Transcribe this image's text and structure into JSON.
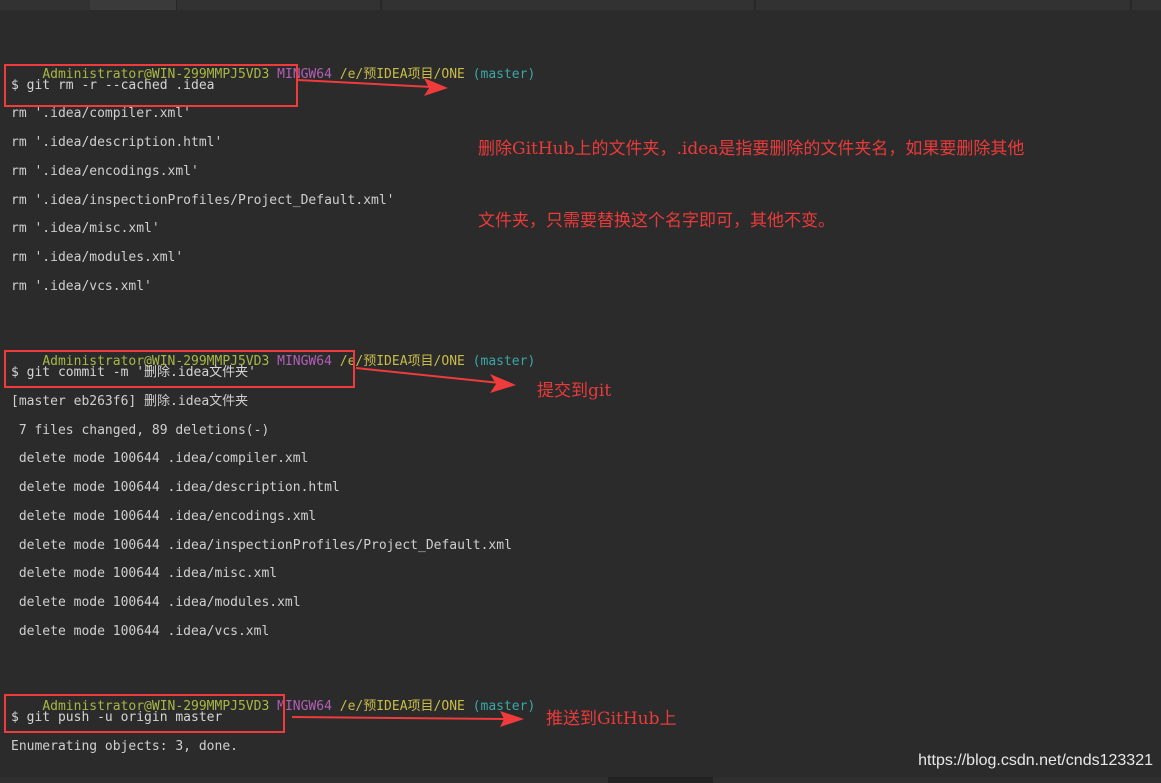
{
  "prompt": {
    "user": "Administrator@WIN-299MMPJ5VD3",
    "msys": "MINGW64",
    "path": "/e/预IDEA项目/ONE",
    "branch": "(master)"
  },
  "block1": {
    "command": "$ git rm -r --cached .idea",
    "output": [
      "rm '.idea/compiler.xml'",
      "rm '.idea/description.html'",
      "rm '.idea/encodings.xml'",
      "rm '.idea/inspectionProfiles/Project_Default.xml'",
      "rm '.idea/misc.xml'",
      "rm '.idea/modules.xml'",
      "rm '.idea/vcs.xml'"
    ],
    "annotation_line1": "删除GitHub上的文件夹，.idea是指要删除的文件夹名，如果要删除其他",
    "annotation_line2": "文件夹，只需要替换这个名字即可，其他不变。"
  },
  "block2": {
    "command": "$ git commit -m '删除.idea文件夹'",
    "output": [
      "[master eb263f6] 删除.idea文件夹",
      " 7 files changed, 89 deletions(-)",
      " delete mode 100644 .idea/compiler.xml",
      " delete mode 100644 .idea/description.html",
      " delete mode 100644 .idea/encodings.xml",
      " delete mode 100644 .idea/inspectionProfiles/Project_Default.xml",
      " delete mode 100644 .idea/misc.xml",
      " delete mode 100644 .idea/modules.xml",
      " delete mode 100644 .idea/vcs.xml"
    ],
    "annotation": "提交到git"
  },
  "block3": {
    "command": "$ git push -u origin master",
    "output": [
      "Enumerating objects: 3, done."
    ],
    "annotation": "推送到GitHub上"
  },
  "watermark": "https://blog.csdn.net/cnds123321",
  "colors": {
    "background": "#2b2b2b",
    "prompt_user": "#a8b843",
    "prompt_msys": "#b15fb6",
    "prompt_path": "#c8bc47",
    "prompt_branch": "#3aa7a7",
    "annotation_red": "#ea3a3a"
  }
}
